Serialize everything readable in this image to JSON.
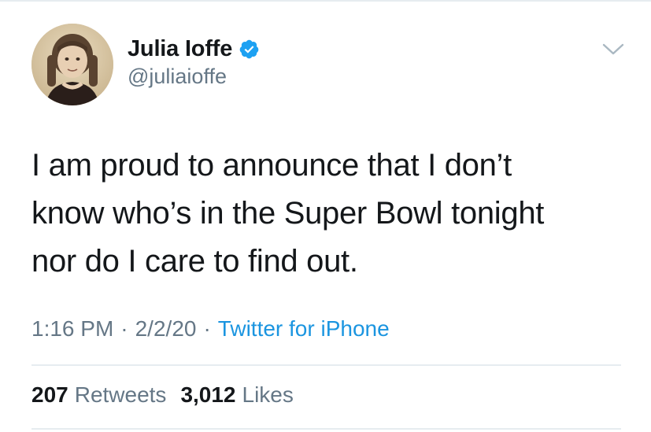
{
  "author": {
    "display_name": "Julia Ioffe",
    "handle": "@juliaioffe",
    "verified": true,
    "avatar_icon": "profile-photo"
  },
  "tweet": {
    "lines": [
      "I am proud to announce that I don’t",
      "know who’s in the Super Bowl tonight",
      "nor do I care to find out."
    ]
  },
  "meta": {
    "time": "1:16 PM",
    "date": "2/2/20",
    "separator": "·",
    "source": "Twitter for iPhone"
  },
  "stats": {
    "retweets_count": "207",
    "retweets_label": "Retweets",
    "likes_count": "3,012",
    "likes_label": "Likes"
  },
  "colors": {
    "text_primary": "#14171a",
    "text_secondary": "#657786",
    "link_blue": "#1b95e0",
    "divider": "#e6ecf0",
    "verified_blue": "#1da1f2"
  },
  "icons": {
    "verified": "verified-badge-icon",
    "menu": "chevron-down-icon"
  }
}
